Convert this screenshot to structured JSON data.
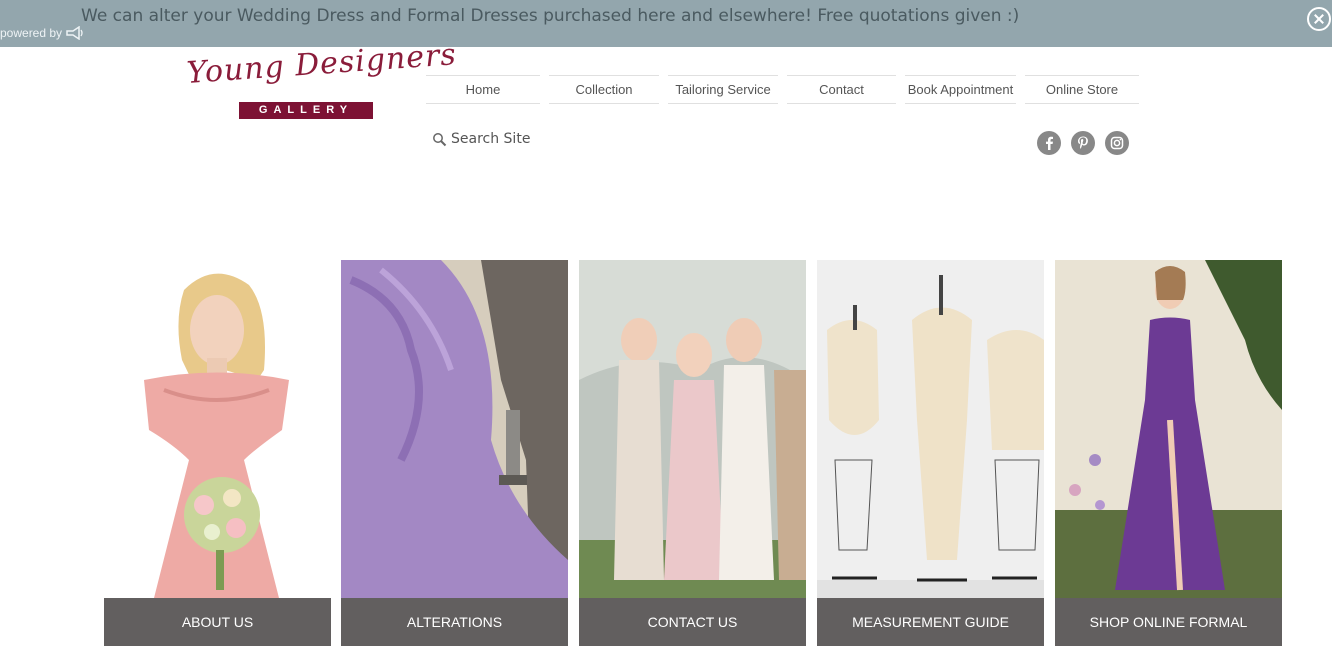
{
  "announcement": {
    "text": "We can alter your Wedding Dress and Formal Dresses purchased here and elsewhere! Free quotations given :)",
    "powered_by": "powered by",
    "close_icon": "close-circle-icon"
  },
  "logo": {
    "script_text": "Young Designers",
    "box_text": "GALLERY"
  },
  "nav": {
    "items": [
      {
        "label": "Home"
      },
      {
        "label": "Collection"
      },
      {
        "label": "Tailoring Service"
      },
      {
        "label": "Contact"
      },
      {
        "label": "Book Appointment"
      },
      {
        "label": "Online Store"
      }
    ]
  },
  "search": {
    "label": "Search Site",
    "icon": "search-icon"
  },
  "social": {
    "items": [
      {
        "name": "facebook-icon"
      },
      {
        "name": "pinterest-icon"
      },
      {
        "name": "instagram-icon"
      }
    ],
    "color": "#888888"
  },
  "tiles": [
    {
      "label": "ABOUT US"
    },
    {
      "label": "ALTERATIONS"
    },
    {
      "label": "CONTACT US"
    },
    {
      "label": "MEASUREMENT GUIDE"
    },
    {
      "label": "SHOP ONLINE FORMAL"
    }
  ],
  "colors": {
    "announcement_bg": "#93a6ad",
    "brand": "#7d1234",
    "tile_label_bg": "#625f5f"
  }
}
